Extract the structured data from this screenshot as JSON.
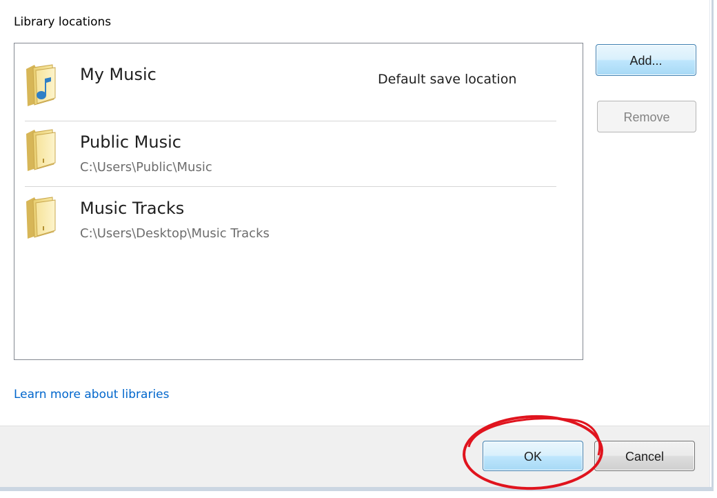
{
  "section_label": "Library locations",
  "locations": [
    {
      "name": "My Music",
      "path": "",
      "note": "Default save location",
      "icon": "music-folder-icon"
    },
    {
      "name": "Public Music",
      "path": "C:\\Users\\Public\\Music",
      "note": "",
      "icon": "folder-icon"
    },
    {
      "name": "Music Tracks",
      "path": "C:\\Users\\Desktop\\Music Tracks",
      "note": "",
      "icon": "folder-icon"
    }
  ],
  "buttons": {
    "add": "Add...",
    "remove": "Remove",
    "ok": "OK",
    "cancel": "Cancel"
  },
  "link": {
    "learn_more": "Learn more about libraries"
  },
  "colors": {
    "link": "#0066cc",
    "highlight_annotation": "#e0141e",
    "footer_background": "#f0f0f0",
    "default_button_border": "#3c7fb1"
  }
}
